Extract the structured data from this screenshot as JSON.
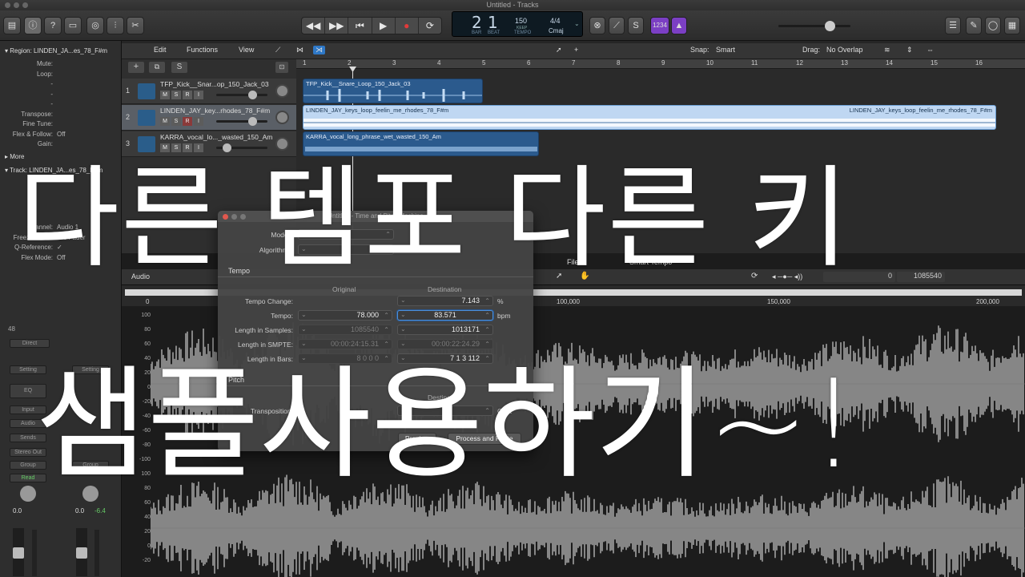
{
  "window_title": "Untitled - Tracks",
  "lcd": {
    "bar": "2",
    "beat": "1",
    "bar_label": "BAR",
    "beat_label": "BEAT",
    "tempo": "150",
    "keep": "KEEP",
    "tempo_label": "TEMPO",
    "time_sig": "4/4",
    "key": "Cmaj"
  },
  "count_in": "1234",
  "menubar": {
    "edit": "Edit",
    "functions": "Functions",
    "view": "View",
    "snap_label": "Snap:",
    "snap_value": "Smart",
    "drag_label": "Drag:",
    "drag_value": "No Overlap"
  },
  "ruler_ticks": [
    "1",
    "2",
    "3",
    "4",
    "5",
    "6",
    "7",
    "8",
    "9",
    "10",
    "11",
    "12",
    "13",
    "14",
    "15",
    "16"
  ],
  "inspector": {
    "region_header": "Region: LINDEN_JA...es_78_F#m",
    "rows": [
      {
        "k": "Mute:",
        "v": ""
      },
      {
        "k": "Loop:",
        "v": ""
      },
      {
        "k": "-",
        "v": ""
      },
      {
        "k": "-",
        "v": ""
      },
      {
        "k": "-",
        "v": ""
      },
      {
        "k": "Transpose:",
        "v": ""
      },
      {
        "k": "Fine Tune:",
        "v": ""
      },
      {
        "k": "Flex & Follow:",
        "v": "Off"
      },
      {
        "k": "Gain:",
        "v": ""
      }
    ],
    "more": "More",
    "track_header": "Track: LINDEN_JA...es_78_F#m",
    "track_rows": [
      {
        "k": "Channel:",
        "v": "Audio 1"
      },
      {
        "k": "Freeze Mode:",
        "v": "Pre Fader"
      },
      {
        "k": "Q-Reference:",
        "v": "✓"
      },
      {
        "k": "Flex Mode:",
        "v": "Off"
      }
    ],
    "strip": {
      "direct": "Direct",
      "setting": "Setting",
      "eq": "EQ",
      "input": "Input",
      "audio": "Audio",
      "sends": "Sends",
      "stereo_out": "Stereo Out",
      "group": "Group",
      "read": "Read",
      "vol_left": "0.0",
      "vol_right_a": "0.0",
      "vol_right_b": "-6.4",
      "num48": "48"
    }
  },
  "tracks": [
    {
      "num": "1",
      "name": "TFP_Kick__Snar...op_150_Jack_03",
      "region": "TFP_Kick__Snare_Loop_150_Jack_03"
    },
    {
      "num": "2",
      "name": "LINDEN_JAY_key...rhodes_78_F#m",
      "region": "LINDEN_JAY_keys_loop_feelin_me_rhodes_78_F#m",
      "region_end": "LINDEN_JAY_keys_loop_feelin_me_rhodes_78_F#m"
    },
    {
      "num": "3",
      "name": "KARRA_vocal_lo..._wasted_150_Am",
      "region": "KARRA_vocal_long_phrase_wet_wasted_150_Am"
    }
  ],
  "editor": {
    "audio_tab": "Audio",
    "file_tab": "File",
    "smart_tempo_tab": "Smart Tempo",
    "counter_a": "0",
    "counter_b": "1085540",
    "ov_0": "0",
    "ov_100k": "100,000",
    "ov_150k": "150,000",
    "ov_200k": "200,000",
    "amp_ticks": [
      "100",
      "80",
      "60",
      "40",
      "20",
      "0",
      "-20",
      "-40",
      "-60",
      "-80",
      "-100",
      "100",
      "80",
      "60",
      "40",
      "20",
      "0",
      "-20"
    ]
  },
  "dialog": {
    "title": "Untitled - Time and Pitch Machine",
    "mode_label": "Mode:",
    "mode_value": "Free",
    "algorithm_label": "Algorithm:",
    "tempo_section": "Tempo",
    "col_original": "Original",
    "col_destination": "Destination",
    "tempo_change_label": "Tempo Change:",
    "tempo_change_value": "7.143",
    "tempo_change_unit": "%",
    "tempo_label": "Tempo:",
    "tempo_orig": "78.000",
    "tempo_dest": "83.571",
    "tempo_unit": "bpm",
    "samples_label": "Length in Samples:",
    "samples_orig": "1085540",
    "samples_dest": "1013171",
    "smpte_label": "Length in SMPTE:",
    "smpte_orig": "00:00:24:15.31",
    "smpte_dest": "00:00:22:24.29",
    "bars_label": "Length in Bars:",
    "bars_orig": "8 0 0 0",
    "bars_dest": "7 1 3 112",
    "pitch_section": "Pitch",
    "pitch_destination": "Destination",
    "transpose_label": "Transposition:",
    "transpose_unit": "Cent",
    "preview_btn": "Preview",
    "process_btn": "Process and Paste"
  },
  "overlay": {
    "line1": "다른 템포 다른 키",
    "line2": "샘플사용하기~!"
  }
}
